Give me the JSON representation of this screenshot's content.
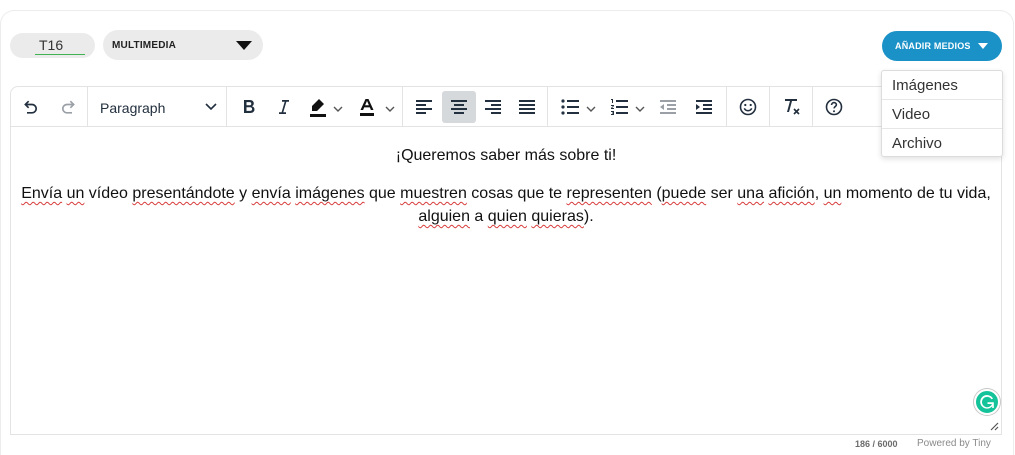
{
  "tag": {
    "value": "T16"
  },
  "type_select": {
    "label": "MULTIMEDIA"
  },
  "add_media": {
    "label": "AÑADIR MEDIOS",
    "color": "#1a92c7"
  },
  "media_menu": {
    "items": [
      "Imágenes",
      "Video",
      "Archivo"
    ]
  },
  "toolbar": {
    "undo_icon": "undo-icon",
    "redo_icon": "redo-icon",
    "block_format": "Paragraph",
    "active_alignment": "align-center",
    "text_color": "#111111"
  },
  "content": {
    "heading": "¡Queremos saber más sobre ti!",
    "body": {
      "segments": [
        {
          "text": "Envía",
          "flag": true
        },
        {
          "text": " ",
          "flag": false
        },
        {
          "text": "un",
          "flag": true
        },
        {
          "text": " vídeo ",
          "flag": false
        },
        {
          "text": "presentándote",
          "flag": true
        },
        {
          "text": " y ",
          "flag": false
        },
        {
          "text": "envía",
          "flag": true
        },
        {
          "text": " ",
          "flag": false
        },
        {
          "text": "imágenes",
          "flag": true
        },
        {
          "text": " que ",
          "flag": false
        },
        {
          "text": "muestren",
          "flag": true
        },
        {
          "text": " cosas que te ",
          "flag": false
        },
        {
          "text": "representen",
          "flag": true
        },
        {
          "text": " (",
          "flag": false
        },
        {
          "text": "puede",
          "flag": true
        },
        {
          "text": " ser ",
          "flag": false
        },
        {
          "text": "una",
          "flag": true
        },
        {
          "text": " ",
          "flag": false
        },
        {
          "text": "afición",
          "flag": true
        },
        {
          "text": ", ",
          "flag": false
        },
        {
          "text": "un",
          "flag": true
        },
        {
          "text": " momento de tu vida, ",
          "flag": false
        },
        {
          "text": "alguien",
          "flag": true
        },
        {
          "text": " a ",
          "flag": false
        },
        {
          "text": "quien",
          "flag": true
        },
        {
          "text": " ",
          "flag": false
        },
        {
          "text": "quieras",
          "flag": true
        },
        {
          "text": ").",
          "flag": false
        }
      ]
    }
  },
  "footer": {
    "char_count": "186 / 6000",
    "powered_by": "Powered by Tiny"
  },
  "colors": {
    "spellcheck_underline": "#d83b3b",
    "grammarly": "#15c39a",
    "active_button": "#d6d9dc"
  }
}
